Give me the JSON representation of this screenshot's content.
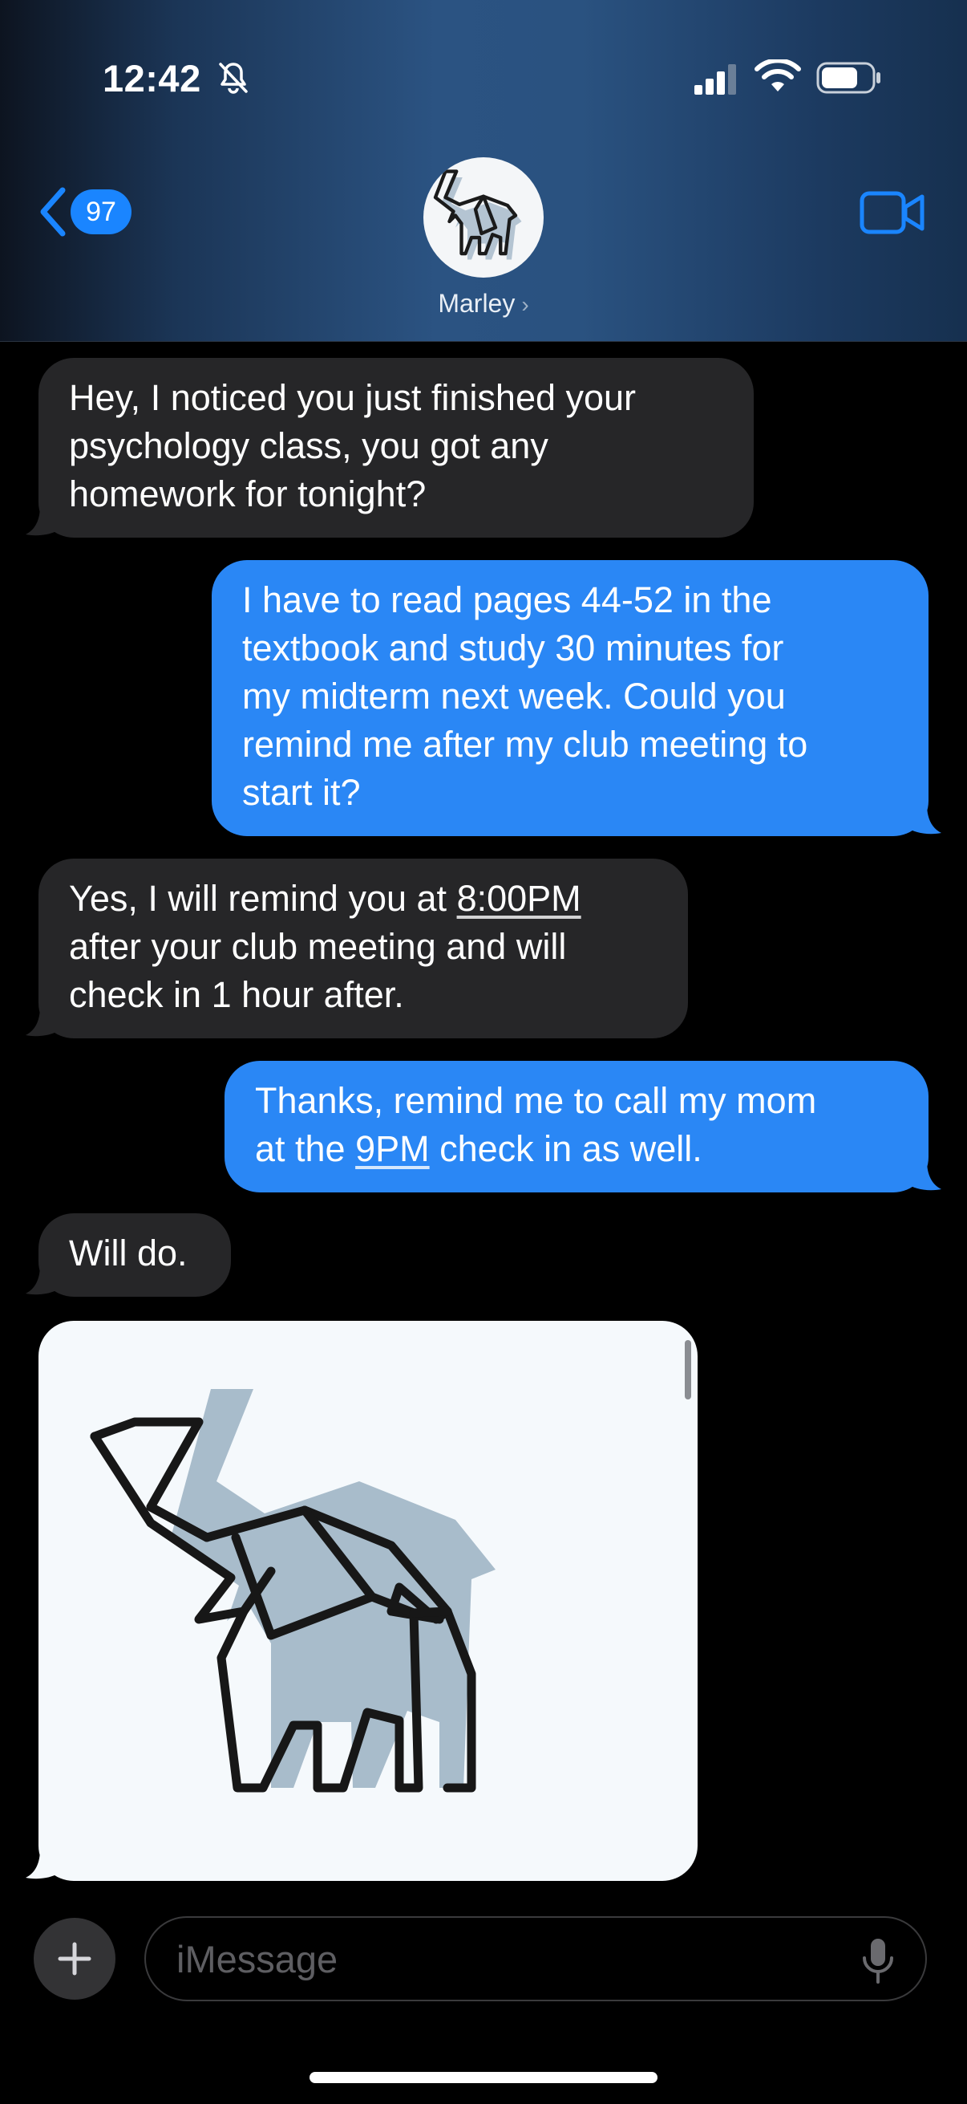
{
  "status_bar": {
    "time": "12:42"
  },
  "header": {
    "back_count": "97",
    "contact_name": "Marley",
    "chevron": "›"
  },
  "messages": [
    {
      "side": "incoming",
      "lines": [
        "Hey, I noticed you just finished your",
        "psychology class, you got any",
        "homework for tonight?"
      ]
    },
    {
      "side": "outgoing",
      "lines": [
        "I have to read pages 44-52 in the",
        "textbook and study 30 minutes for",
        "my midterm next week. Could you",
        "remind me after my club meeting to",
        "start it?"
      ]
    },
    {
      "side": "incoming",
      "line1_before": "Yes, I will remind you at ",
      "line1_link": "8:00PM",
      "lines_rest": [
        "after your club meeting and will",
        "check in 1 hour after."
      ]
    },
    {
      "side": "outgoing",
      "line1": "Thanks, remind me to call my mom",
      "line2_before": "at the ",
      "line2_link": "9PM",
      "line2_after": " check in as well."
    },
    {
      "side": "incoming",
      "lines": [
        "Will do."
      ]
    },
    {
      "side": "incoming",
      "type": "image",
      "icon": "elephant-icon"
    }
  ],
  "composer": {
    "placeholder": "iMessage"
  },
  "colors": {
    "incoming": "#262628",
    "outgoing": "#2a87f5",
    "accent": "#1a85ff"
  }
}
